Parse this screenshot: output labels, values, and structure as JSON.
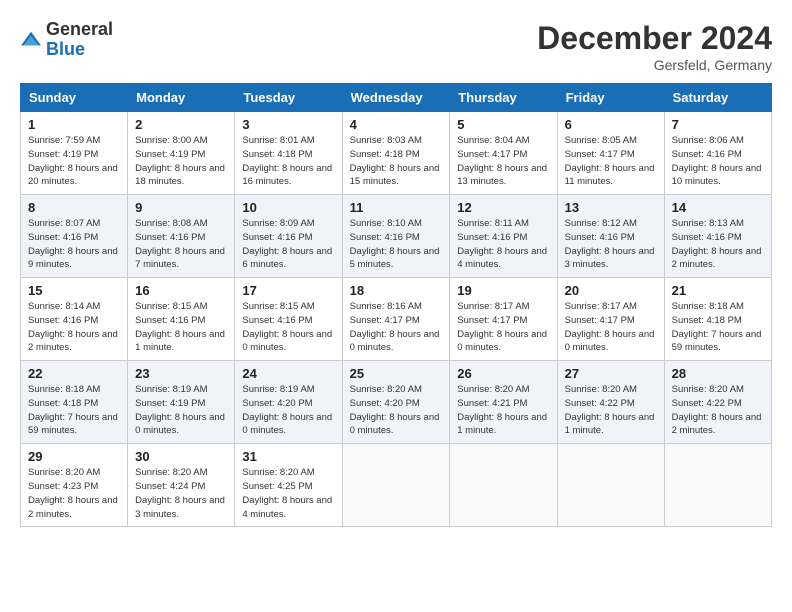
{
  "header": {
    "logo_general": "General",
    "logo_blue": "Blue",
    "month": "December 2024",
    "location": "Gersfeld, Germany"
  },
  "days_of_week": [
    "Sunday",
    "Monday",
    "Tuesday",
    "Wednesday",
    "Thursday",
    "Friday",
    "Saturday"
  ],
  "weeks": [
    [
      {
        "day": "1",
        "sunrise": "Sunrise: 7:59 AM",
        "sunset": "Sunset: 4:19 PM",
        "daylight": "Daylight: 8 hours and 20 minutes."
      },
      {
        "day": "2",
        "sunrise": "Sunrise: 8:00 AM",
        "sunset": "Sunset: 4:19 PM",
        "daylight": "Daylight: 8 hours and 18 minutes."
      },
      {
        "day": "3",
        "sunrise": "Sunrise: 8:01 AM",
        "sunset": "Sunset: 4:18 PM",
        "daylight": "Daylight: 8 hours and 16 minutes."
      },
      {
        "day": "4",
        "sunrise": "Sunrise: 8:03 AM",
        "sunset": "Sunset: 4:18 PM",
        "daylight": "Daylight: 8 hours and 15 minutes."
      },
      {
        "day": "5",
        "sunrise": "Sunrise: 8:04 AM",
        "sunset": "Sunset: 4:17 PM",
        "daylight": "Daylight: 8 hours and 13 minutes."
      },
      {
        "day": "6",
        "sunrise": "Sunrise: 8:05 AM",
        "sunset": "Sunset: 4:17 PM",
        "daylight": "Daylight: 8 hours and 11 minutes."
      },
      {
        "day": "7",
        "sunrise": "Sunrise: 8:06 AM",
        "sunset": "Sunset: 4:16 PM",
        "daylight": "Daylight: 8 hours and 10 minutes."
      }
    ],
    [
      {
        "day": "8",
        "sunrise": "Sunrise: 8:07 AM",
        "sunset": "Sunset: 4:16 PM",
        "daylight": "Daylight: 8 hours and 9 minutes."
      },
      {
        "day": "9",
        "sunrise": "Sunrise: 8:08 AM",
        "sunset": "Sunset: 4:16 PM",
        "daylight": "Daylight: 8 hours and 7 minutes."
      },
      {
        "day": "10",
        "sunrise": "Sunrise: 8:09 AM",
        "sunset": "Sunset: 4:16 PM",
        "daylight": "Daylight: 8 hours and 6 minutes."
      },
      {
        "day": "11",
        "sunrise": "Sunrise: 8:10 AM",
        "sunset": "Sunset: 4:16 PM",
        "daylight": "Daylight: 8 hours and 5 minutes."
      },
      {
        "day": "12",
        "sunrise": "Sunrise: 8:11 AM",
        "sunset": "Sunset: 4:16 PM",
        "daylight": "Daylight: 8 hours and 4 minutes."
      },
      {
        "day": "13",
        "sunrise": "Sunrise: 8:12 AM",
        "sunset": "Sunset: 4:16 PM",
        "daylight": "Daylight: 8 hours and 3 minutes."
      },
      {
        "day": "14",
        "sunrise": "Sunrise: 8:13 AM",
        "sunset": "Sunset: 4:16 PM",
        "daylight": "Daylight: 8 hours and 2 minutes."
      }
    ],
    [
      {
        "day": "15",
        "sunrise": "Sunrise: 8:14 AM",
        "sunset": "Sunset: 4:16 PM",
        "daylight": "Daylight: 8 hours and 2 minutes."
      },
      {
        "day": "16",
        "sunrise": "Sunrise: 8:15 AM",
        "sunset": "Sunset: 4:16 PM",
        "daylight": "Daylight: 8 hours and 1 minute."
      },
      {
        "day": "17",
        "sunrise": "Sunrise: 8:15 AM",
        "sunset": "Sunset: 4:16 PM",
        "daylight": "Daylight: 8 hours and 0 minutes."
      },
      {
        "day": "18",
        "sunrise": "Sunrise: 8:16 AM",
        "sunset": "Sunset: 4:17 PM",
        "daylight": "Daylight: 8 hours and 0 minutes."
      },
      {
        "day": "19",
        "sunrise": "Sunrise: 8:17 AM",
        "sunset": "Sunset: 4:17 PM",
        "daylight": "Daylight: 8 hours and 0 minutes."
      },
      {
        "day": "20",
        "sunrise": "Sunrise: 8:17 AM",
        "sunset": "Sunset: 4:17 PM",
        "daylight": "Daylight: 8 hours and 0 minutes."
      },
      {
        "day": "21",
        "sunrise": "Sunrise: 8:18 AM",
        "sunset": "Sunset: 4:18 PM",
        "daylight": "Daylight: 7 hours and 59 minutes."
      }
    ],
    [
      {
        "day": "22",
        "sunrise": "Sunrise: 8:18 AM",
        "sunset": "Sunset: 4:18 PM",
        "daylight": "Daylight: 7 hours and 59 minutes."
      },
      {
        "day": "23",
        "sunrise": "Sunrise: 8:19 AM",
        "sunset": "Sunset: 4:19 PM",
        "daylight": "Daylight: 8 hours and 0 minutes."
      },
      {
        "day": "24",
        "sunrise": "Sunrise: 8:19 AM",
        "sunset": "Sunset: 4:20 PM",
        "daylight": "Daylight: 8 hours and 0 minutes."
      },
      {
        "day": "25",
        "sunrise": "Sunrise: 8:20 AM",
        "sunset": "Sunset: 4:20 PM",
        "daylight": "Daylight: 8 hours and 0 minutes."
      },
      {
        "day": "26",
        "sunrise": "Sunrise: 8:20 AM",
        "sunset": "Sunset: 4:21 PM",
        "daylight": "Daylight: 8 hours and 1 minute."
      },
      {
        "day": "27",
        "sunrise": "Sunrise: 8:20 AM",
        "sunset": "Sunset: 4:22 PM",
        "daylight": "Daylight: 8 hours and 1 minute."
      },
      {
        "day": "28",
        "sunrise": "Sunrise: 8:20 AM",
        "sunset": "Sunset: 4:22 PM",
        "daylight": "Daylight: 8 hours and 2 minutes."
      }
    ],
    [
      {
        "day": "29",
        "sunrise": "Sunrise: 8:20 AM",
        "sunset": "Sunset: 4:23 PM",
        "daylight": "Daylight: 8 hours and 2 minutes."
      },
      {
        "day": "30",
        "sunrise": "Sunrise: 8:20 AM",
        "sunset": "Sunset: 4:24 PM",
        "daylight": "Daylight: 8 hours and 3 minutes."
      },
      {
        "day": "31",
        "sunrise": "Sunrise: 8:20 AM",
        "sunset": "Sunset: 4:25 PM",
        "daylight": "Daylight: 8 hours and 4 minutes."
      },
      null,
      null,
      null,
      null
    ]
  ]
}
